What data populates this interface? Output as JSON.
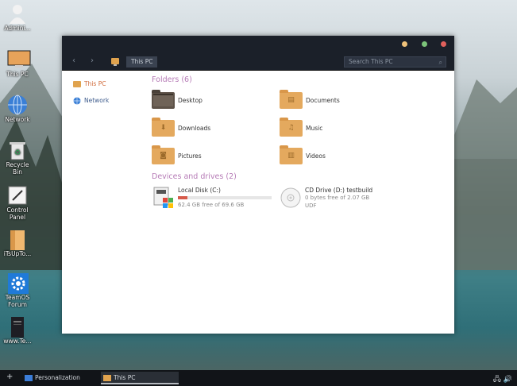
{
  "desktop": {
    "icons": [
      {
        "label": "Admini...",
        "icon": "user-icon"
      },
      {
        "label": "This PC",
        "icon": "computer-icon"
      },
      {
        "label": "Network",
        "icon": "network-globe-icon"
      },
      {
        "label": "Recycle Bin",
        "icon": "recycle-bin-icon"
      },
      {
        "label": "Control Panel",
        "icon": "control-panel-icon"
      },
      {
        "label": "iTsUpTo...",
        "icon": "folder-icon"
      },
      {
        "label": "TeamOS Forum",
        "icon": "gear-icon"
      },
      {
        "label": "www.Te...",
        "icon": "book-icon"
      }
    ]
  },
  "window": {
    "title_buttons": {
      "minimize_color": "#f0c27a",
      "maximize_color": "#7cc47a",
      "close_color": "#e0605c"
    },
    "nav": {
      "back": "‹",
      "forward": "›"
    },
    "address": {
      "crumb": "This PC",
      "icon": "computer-icon"
    },
    "search": {
      "placeholder": "Search This PC",
      "icon": "search-icon"
    },
    "sidebar": {
      "items": [
        {
          "label": "This PC",
          "icon": "computer-icon"
        },
        {
          "label": "Network",
          "icon": "network-globe-icon"
        }
      ]
    },
    "folders_header": "Folders (6)",
    "folders": [
      {
        "label": "Desktop",
        "icon": "desktop-folder-icon"
      },
      {
        "label": "Documents",
        "icon": "documents-folder-icon"
      },
      {
        "label": "Downloads",
        "icon": "downloads-folder-icon"
      },
      {
        "label": "Music",
        "icon": "music-folder-icon"
      },
      {
        "label": "Pictures",
        "icon": "pictures-folder-icon"
      },
      {
        "label": "Videos",
        "icon": "videos-folder-icon"
      }
    ],
    "drives_header": "Devices and drives (2)",
    "drives": [
      {
        "name": "Local Disk (C:)",
        "free": "62.4 GB free of 69.6 GB",
        "used_fraction": 0.1,
        "icon": "local-disk-icon"
      },
      {
        "name": "CD Drive (D:) testbuild",
        "free": "0 bytes free of 2.07 GB",
        "fs": "UDF",
        "icon": "cd-drive-icon"
      }
    ]
  },
  "taskbar": {
    "tasks": [
      {
        "label": "Personalization",
        "icon": "personalization-icon"
      },
      {
        "label": "This PC",
        "icon": "computer-icon"
      }
    ]
  }
}
